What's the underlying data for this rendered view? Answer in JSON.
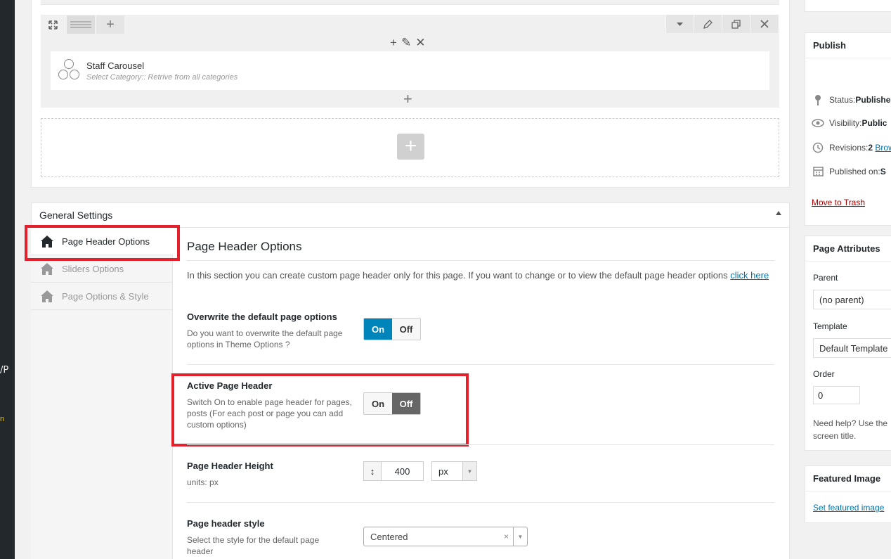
{
  "admin_bar": {
    "fragment_1": "/P",
    "fragment_2": "n"
  },
  "builder": {
    "row_tools": {
      "expand_icon": "expand-icon",
      "drag_icon": "drag-handle-icon",
      "add_icon": "plus-icon"
    },
    "right_tools": [
      "chevron-down-icon",
      "pencil-icon",
      "clone-icon",
      "close-icon"
    ],
    "element_tools": [
      "+",
      "✎",
      "✕"
    ],
    "element": {
      "title": "Staff Carousel",
      "subtitle": "Select Category:: Retrive from all categories"
    },
    "add_below": "+",
    "add_row": "+"
  },
  "general_settings": {
    "title": "General Settings",
    "nav": [
      {
        "label": "Page Header Options",
        "active": true
      },
      {
        "label": "Sliders Options",
        "active": false
      },
      {
        "label": "Page Options & Style",
        "active": false
      }
    ]
  },
  "page_header_options": {
    "heading": "Page Header Options",
    "intro": "In this section you can create custom page header only for this page. If you want to change or to view the default page header options ",
    "intro_link": "click here",
    "overwrite": {
      "title": "Overwrite the default page options",
      "desc": "Do you want to overwrite the default page options in Theme Options ?",
      "on": "On",
      "off": "Off",
      "value": "On"
    },
    "active_header": {
      "title": "Active Page Header",
      "desc": "Switch On to enable page header for pages, posts (For each post or page you can add custom options)",
      "on": "On",
      "off": "Off",
      "value": "Off"
    },
    "height": {
      "title": "Page Header Height",
      "desc": "units: px",
      "icon": "↕",
      "value": "400",
      "unit": "px"
    },
    "style": {
      "title": "Page header style",
      "desc": "Select the style for the default page header",
      "value": "Centered",
      "clear": "×"
    }
  },
  "publish": {
    "title": "Publish",
    "status_label": "Status: ",
    "status_value": "Published",
    "visibility_label": "Visibility: ",
    "visibility_value": "Public",
    "revisions_label": "Revisions: ",
    "revisions_value": "2",
    "revisions_link": "Browse",
    "published_label": "Published on: ",
    "published_value": "S",
    "trash": "Move to Trash"
  },
  "page_attributes": {
    "title": "Page Attributes",
    "parent_label": "Parent",
    "parent_value": "(no parent)",
    "template_label": "Template",
    "template_value": "Default Template",
    "order_label": "Order",
    "order_value": "0",
    "help_line1": "Need help? Use the",
    "help_line2": "screen title."
  },
  "featured_image": {
    "title": "Featured Image",
    "link": "Set featured image"
  },
  "colors": {
    "accent": "#0085ba",
    "highlight": "#e3202b",
    "link": "#0073aa",
    "danger": "#a00"
  }
}
